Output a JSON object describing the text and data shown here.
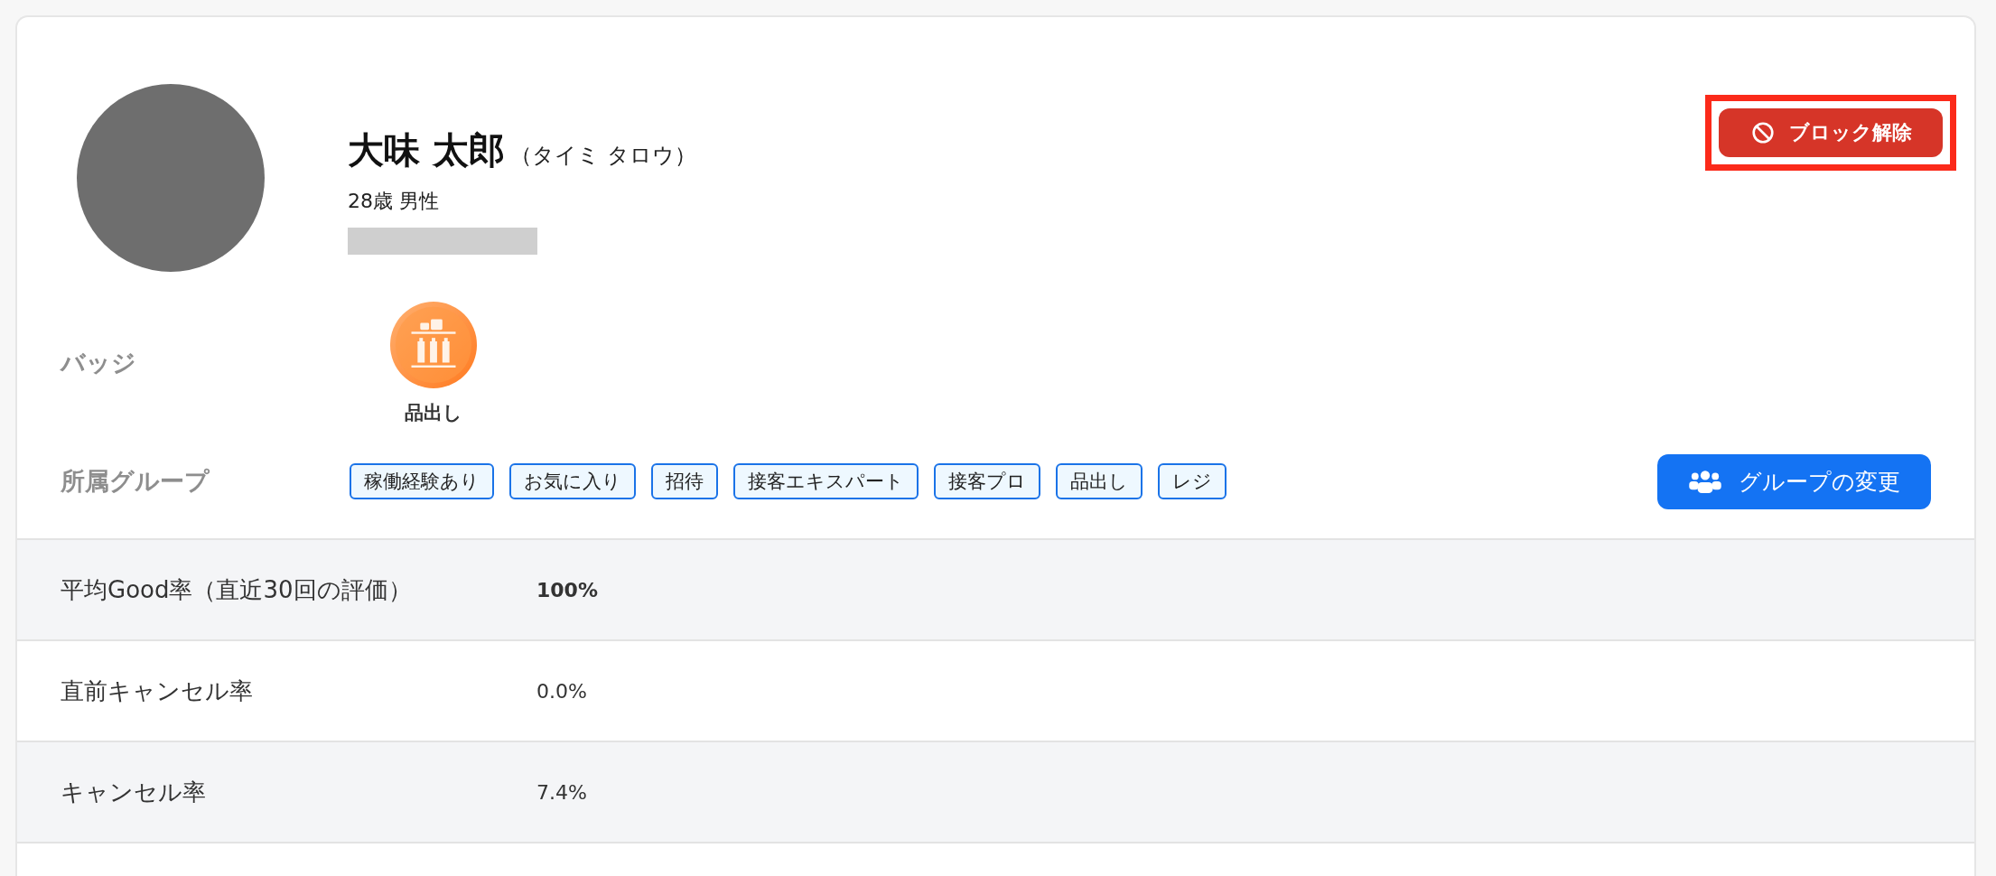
{
  "profile": {
    "name": "大味 太郎",
    "kana": "（タイミ タロウ）",
    "age_gender": "28歳 男性"
  },
  "block_button": {
    "label": "ブロック解除",
    "highlighted": true
  },
  "badges": {
    "label": "バッジ",
    "items": [
      {
        "label": "品出し"
      }
    ]
  },
  "groups": {
    "label": "所属グループ",
    "tags": [
      "稼働経験あり",
      "お気に入り",
      "招待",
      "接客エキスパート",
      "接客プロ",
      "品出し",
      "レジ"
    ],
    "button": "グループの変更"
  },
  "stats": [
    {
      "label": "平均Good率（直近30回の評価）",
      "value": "100%",
      "bold": true
    },
    {
      "label": "直前キャンセル率",
      "value": "0.0%",
      "bold": false
    },
    {
      "label": "キャンセル率",
      "value": "7.4%",
      "bold": false
    }
  ]
}
